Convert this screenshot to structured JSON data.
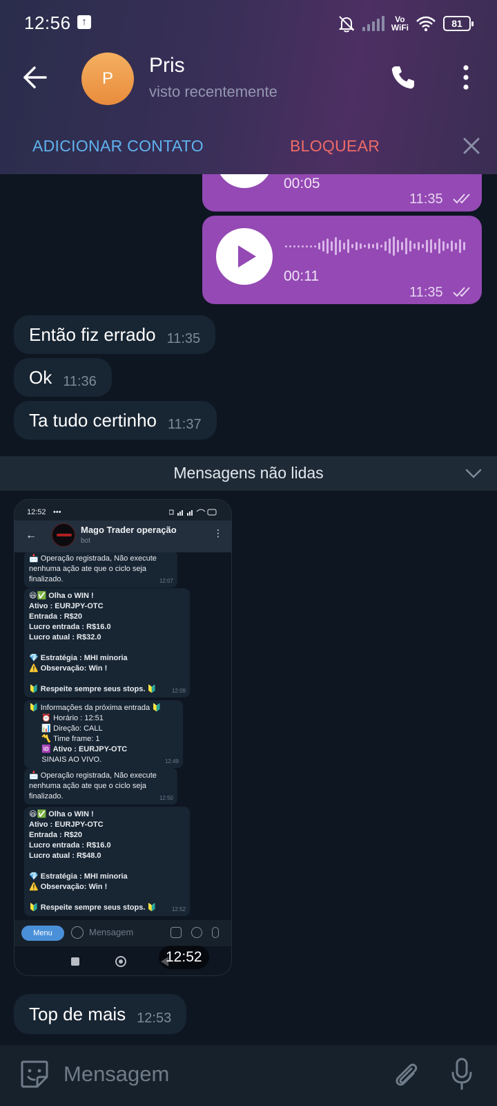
{
  "status_bar": {
    "time": "12:56",
    "vowifi_top": "Vo",
    "vowifi_bottom": "WiFi",
    "battery": "81"
  },
  "contact": {
    "avatar_letter": "P",
    "name": "Pris",
    "status": "visto recentemente",
    "avatar_color": "#ED9A4C"
  },
  "actions": {
    "add_contact": "ADICIONAR CONTATO",
    "block": "BLOQUEAR"
  },
  "voice_messages": [
    {
      "duration": "00:05",
      "time": "11:35"
    },
    {
      "duration": "00:11",
      "time": "11:35"
    }
  ],
  "incoming_messages": [
    {
      "text": "Então fiz errado",
      "time": "11:35"
    },
    {
      "text": "Ok",
      "time": "11:36"
    },
    {
      "text": "Ta tudo certinho",
      "time": "11:37"
    }
  ],
  "unread_divider": "Mensagens não lidas",
  "image_message": {
    "time": "12:52",
    "screenshot": {
      "status_time": "12:52",
      "chat_title": "Mago Trader operação",
      "chat_subtitle": "bot",
      "input_menu": "Menu",
      "input_placeholder": "Mensagem",
      "messages": [
        {
          "lines": [
            "📩 Operação registrada, Não execute",
            "nenhuma ação ate que o ciclo seja",
            "finalizado."
          ],
          "time": "12:07"
        },
        {
          "lines": [
            "😆✅ Olha o WIN !",
            "Ativo : EURJPY-OTC",
            "Entrada : R$20",
            "Lucro entrada : R$16.0",
            "Lucro atual : R$32.0",
            "",
            "💎 Estratégia : MHI minoria",
            "⚠️ Observação: Win !",
            "",
            "🔰 Respeite sempre seus stops. 🔰"
          ],
          "time": "12:09"
        },
        {
          "lines": [
            "🔰 Informações da próxima entrada 🔰",
            "      ⏰ Horário : 12:51",
            "      📊 Direção: CALL",
            "      〽️ Time frame: 1",
            "      🆔 Ativo : EURJPY-OTC",
            "      SINAIS AO VIVO."
          ],
          "time": "12:49"
        },
        {
          "lines": [
            "📩 Operação registrada, Não execute",
            "nenhuma ação ate que o ciclo seja",
            "finalizado."
          ],
          "time": "12:50"
        },
        {
          "lines": [
            "😆✅ Olha o WIN !",
            "Ativo : EURJPY-OTC",
            "Entrada : R$20",
            "Lucro entrada : R$16.0",
            "Lucro atual : R$48.0",
            "",
            "💎 Estratégia : MHI minoria",
            "⚠️ Observação: Win !",
            "",
            "🔰 Respeite sempre seus stops. 🔰"
          ],
          "time": "12:52"
        }
      ]
    }
  },
  "last_message": {
    "text": "Top de mais",
    "time": "12:53"
  },
  "input": {
    "placeholder": "Mensagem"
  },
  "colors": {
    "outgoing_bubble": "#9449B4",
    "incoming_bubble": "#182533",
    "accent_link": "#5FB4F0",
    "danger": "#EF6B67"
  }
}
